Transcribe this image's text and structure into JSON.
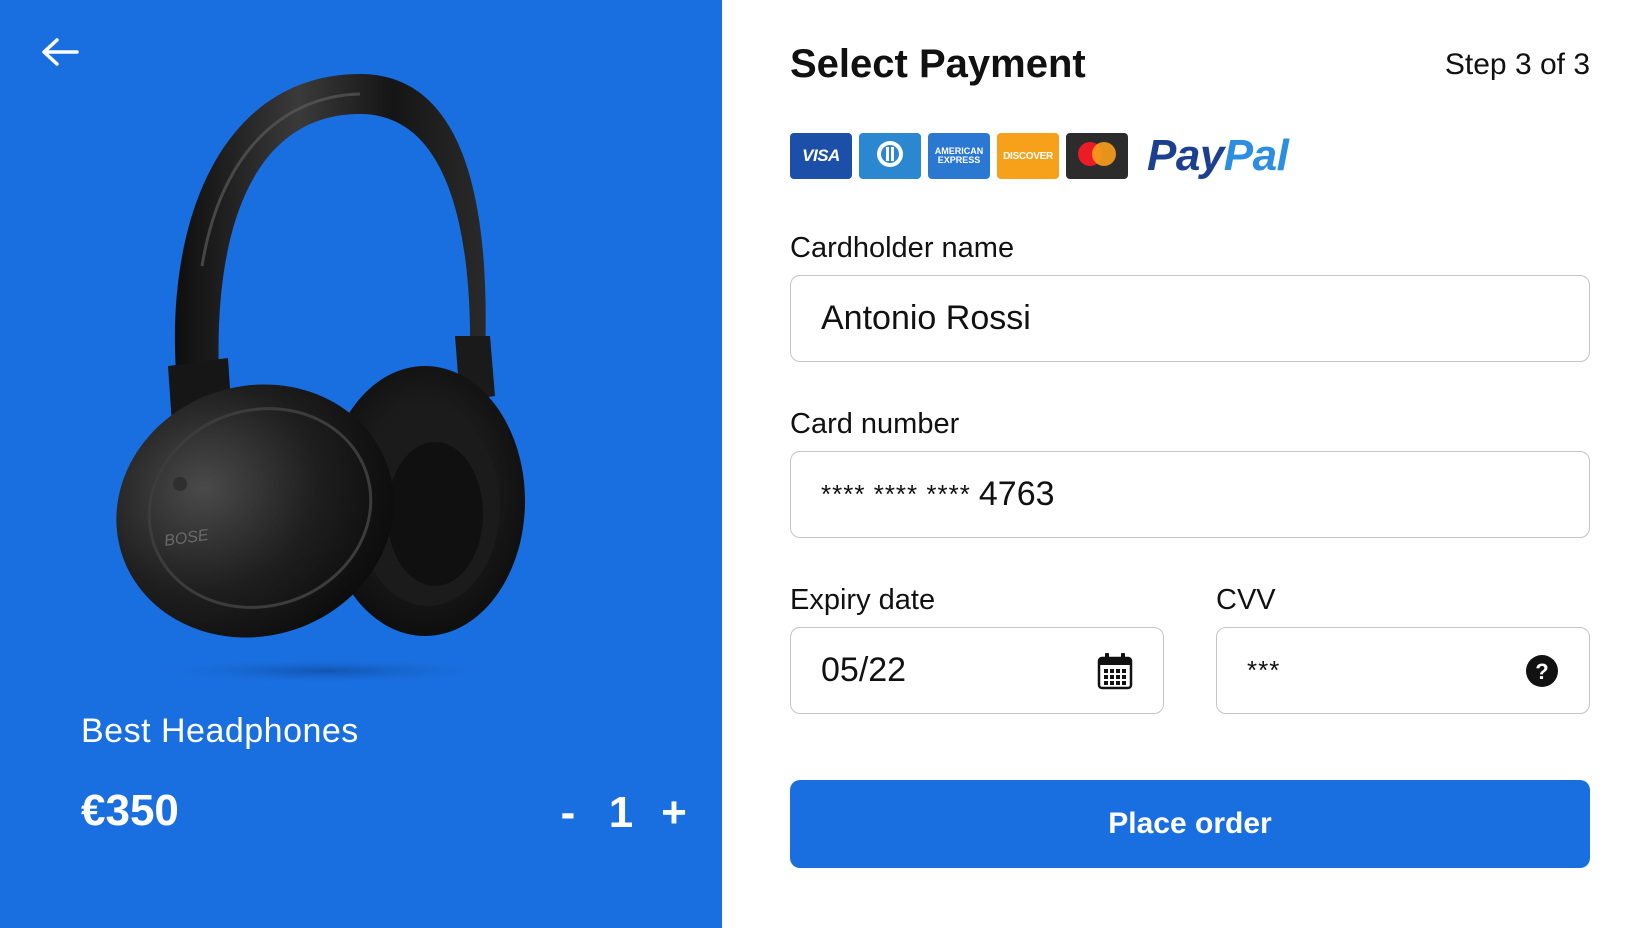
{
  "product": {
    "name": "Best Headphones",
    "price": "€350",
    "quantity": "1",
    "decrement_label": "-",
    "increment_label": "+",
    "back_icon": "arrow-left-icon",
    "image": "black over-ear headphones"
  },
  "payment": {
    "title": "Select Payment",
    "step": "Step 3 of 3",
    "methods": [
      {
        "name": "visa",
        "label": "VISA",
        "color": "#1c4fa8"
      },
      {
        "name": "diners",
        "label": "",
        "color": "#2a87d0"
      },
      {
        "name": "amex",
        "label_line1": "AMERICAN",
        "label_line2": "EXPRESS",
        "color": "#2b78d3"
      },
      {
        "name": "discover",
        "label": "DISCOVER",
        "color": "#f7a11a"
      },
      {
        "name": "mastercard",
        "label": "",
        "color": "#2c2c2c"
      },
      {
        "name": "paypal",
        "label_part1": "Pay",
        "label_part2": "Pal",
        "colors": [
          "#1c3f8f",
          "#2b8ee0"
        ]
      }
    ]
  },
  "form": {
    "cardholder": {
      "label": "Cardholder name",
      "value": "Antonio Rossi"
    },
    "card_number": {
      "label": "Card number",
      "mask": "**** **** ****",
      "value": "4763"
    },
    "expiry": {
      "label": "Expiry date",
      "value": "05/22",
      "icon": "calendar-icon"
    },
    "cvv": {
      "label": "CVV",
      "value": "***",
      "icon": "help-circle-icon"
    }
  },
  "actions": {
    "place_order_label": "Place order"
  },
  "colors": {
    "accent": "#1a6fe0",
    "border": "#c4c4c4",
    "text": "#111111"
  }
}
